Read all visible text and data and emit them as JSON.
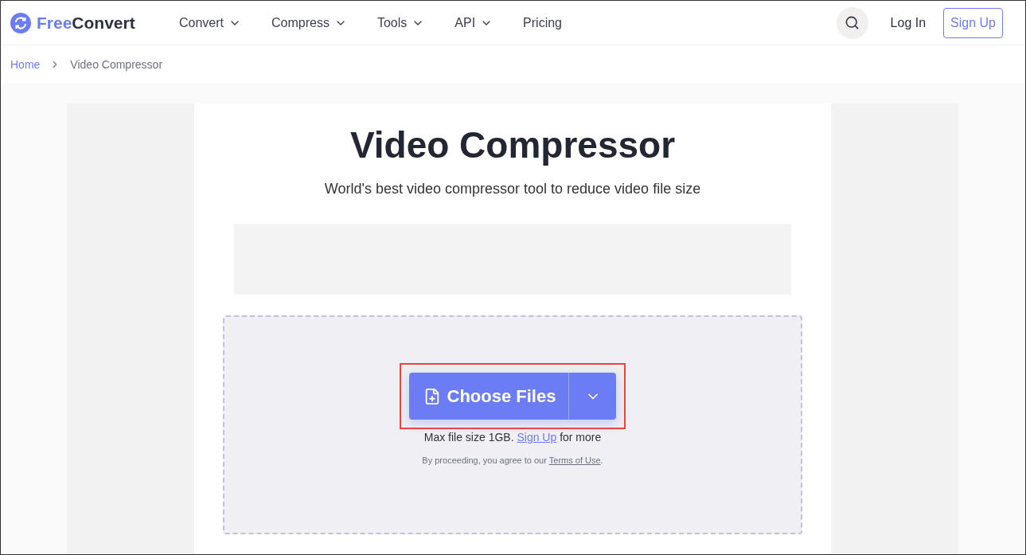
{
  "header": {
    "logo": {
      "accent": "Free",
      "rest": "Convert"
    },
    "nav": [
      {
        "label": "Convert",
        "dropdown": true
      },
      {
        "label": "Compress",
        "dropdown": true
      },
      {
        "label": "Tools",
        "dropdown": true
      },
      {
        "label": "API",
        "dropdown": true
      },
      {
        "label": "Pricing",
        "dropdown": false
      }
    ],
    "login": "Log In",
    "signup": "Sign Up"
  },
  "breadcrumb": [
    "Home",
    "Video Compressor"
  ],
  "title": "Video Compressor",
  "subtitle": "World's best video compressor tool to reduce video file size",
  "upload": {
    "button": "Choose Files",
    "highlighted": true,
    "limit": {
      "before": "Max file size 1GB.",
      "link": "Sign Up",
      "after": "for more"
    },
    "terms": {
      "before": "By proceeding, you agree to our",
      "link": "Terms of Use",
      "after": "."
    }
  }
}
